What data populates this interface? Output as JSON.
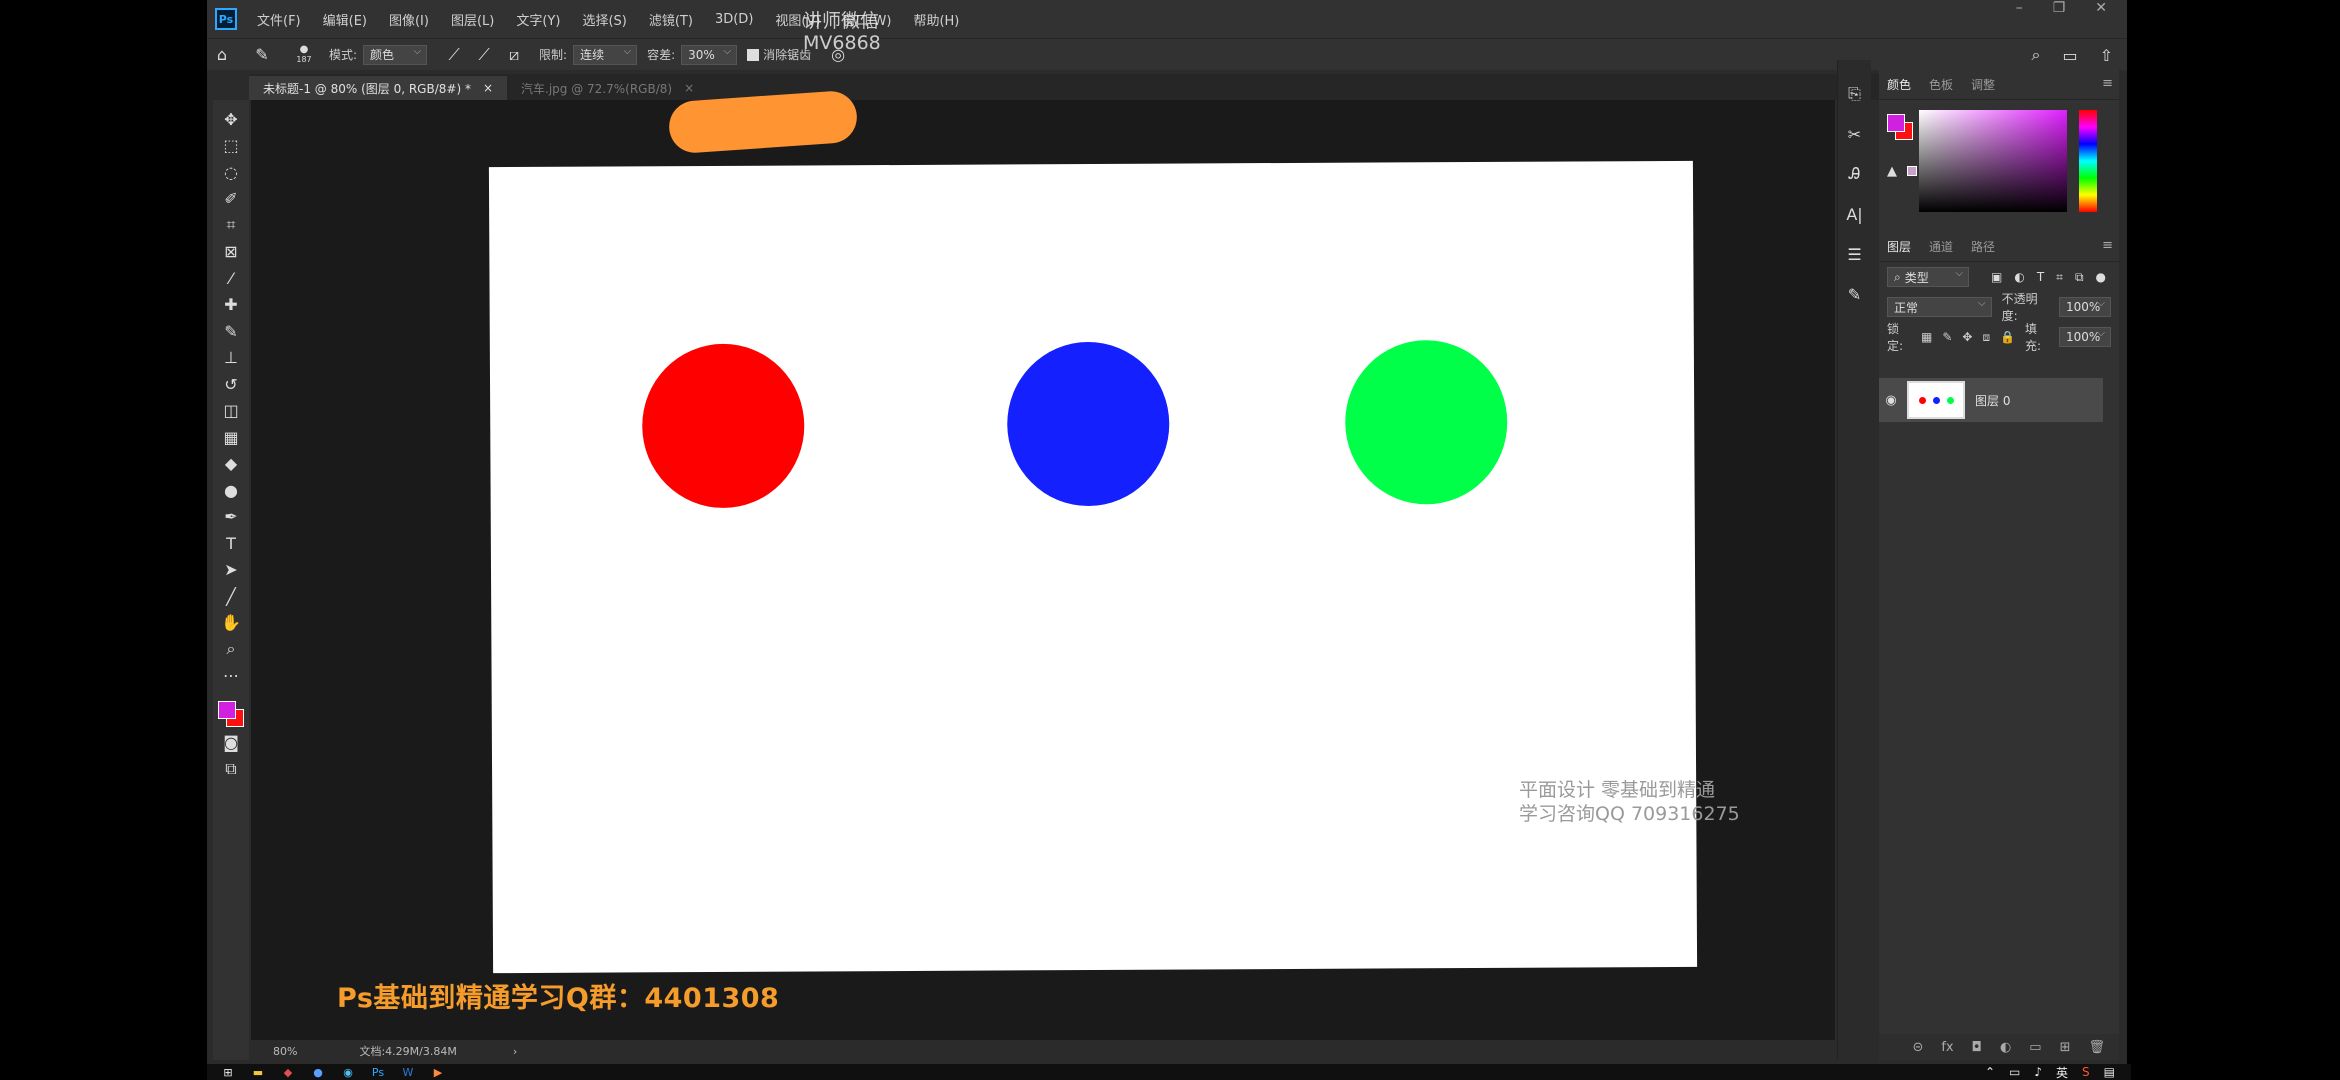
{
  "menubar": {
    "logo": "Ps",
    "items": [
      "文件(F)",
      "编辑(E)",
      "图像(I)",
      "图层(L)",
      "文字(Y)",
      "选择(S)",
      "滤镜(T)",
      "3D(D)",
      "视图(V)",
      "窗口(W)",
      "帮助(H)"
    ],
    "window_controls": [
      "–",
      "❐",
      "✕"
    ]
  },
  "top_watermark": {
    "line1": "讲师微信",
    "line2": "MV6868"
  },
  "options": {
    "brush_size": "187",
    "mode_label": "模式:",
    "mode_value": "颜色",
    "limit_label": "限制:",
    "limit_value": "连续",
    "tolerance_label": "容差:",
    "tolerance_value": "30%",
    "antialias_label": "消除锯齿"
  },
  "tabs": [
    {
      "label": "未标题-1 @ 80% (图层 0, RGB/8#) *",
      "close": "×"
    },
    {
      "label": "汽车.jpg @ 72.7%(RGB/8)",
      "close": "×"
    }
  ],
  "canvas": {
    "circles": [
      {
        "name": "red",
        "color": "#ff0000"
      },
      {
        "name": "blue",
        "color": "#1520ff"
      },
      {
        "name": "green",
        "color": "#00ff48"
      }
    ]
  },
  "canvas_watermark": {
    "line1": "平面设计 零基础到精通",
    "line2": "学习咨询QQ 709316275"
  },
  "qq_banner": "Ps基础到精通学习Q群：4401308",
  "status": {
    "zoom": "80%",
    "doc": "文档:4.29M/3.84M",
    "arrow": "›"
  },
  "colors": {
    "foreground": "#d020e0",
    "background": "#ff1010"
  },
  "color_panel": {
    "tabs": [
      "颜色",
      "色板",
      "调整"
    ]
  },
  "layers_panel": {
    "tabs": [
      "图层",
      "通道",
      "路径"
    ],
    "filter_label": "类型",
    "blend_mode": "正常",
    "opacity_label": "不透明度:",
    "opacity_value": "100%",
    "lock_label": "锁定:",
    "fill_label": "填充:",
    "fill_value": "100%",
    "layer_name": "图层 0"
  },
  "taskbar": {
    "ime": "英"
  }
}
